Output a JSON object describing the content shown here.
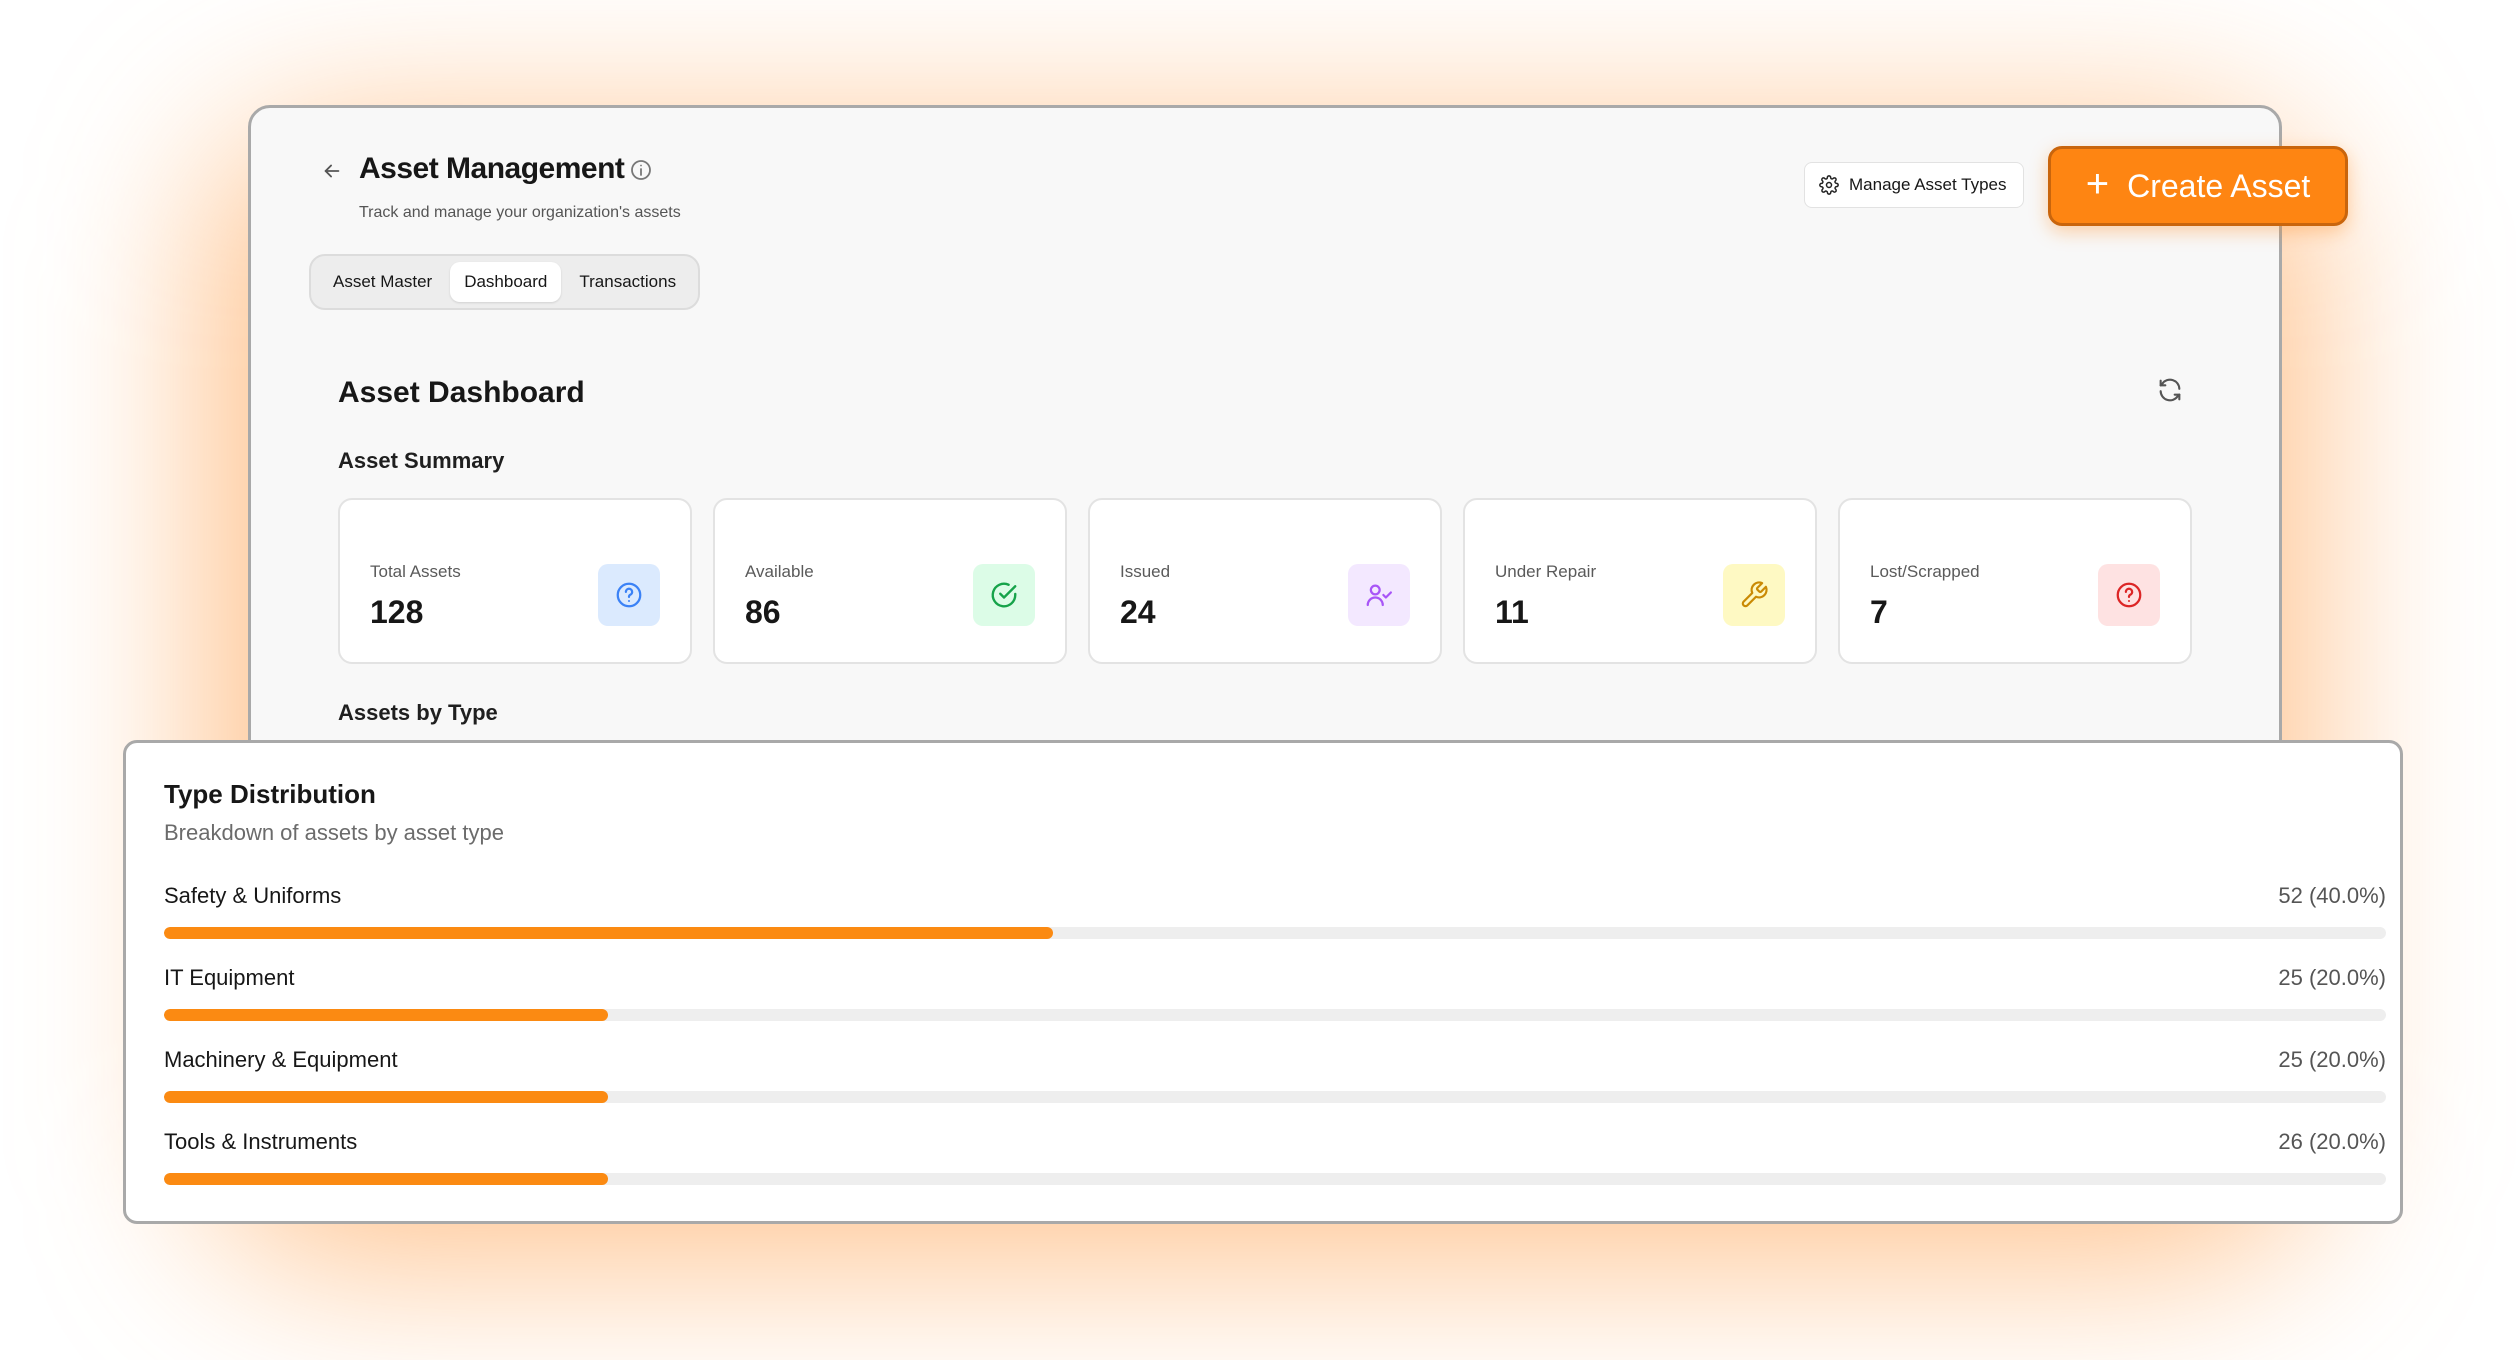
{
  "header": {
    "title": "Asset Management",
    "subtitle": "Track and manage your organization's assets",
    "manage_label": "Manage Asset Types",
    "create_label": "Create Asset"
  },
  "tabs": [
    {
      "label": "Asset Master",
      "active": false
    },
    {
      "label": "Dashboard",
      "active": true
    },
    {
      "label": "Transactions",
      "active": false
    }
  ],
  "dashboard": {
    "title": "Asset Dashboard",
    "summary_title": "Asset Summary",
    "by_type_title": "Assets by Type"
  },
  "summary_cards": [
    {
      "label": "Total Assets",
      "value": "128",
      "icon": "question-circle-icon",
      "icon_color": "#3b82f6",
      "icon_bg": "#dbeafe"
    },
    {
      "label": "Available",
      "value": "86",
      "icon": "check-circle-icon",
      "icon_color": "#16a34a",
      "icon_bg": "#dcfce7"
    },
    {
      "label": "Issued",
      "value": "24",
      "icon": "user-check-icon",
      "icon_color": "#a855f7",
      "icon_bg": "#f3e8ff"
    },
    {
      "label": "Under Repair",
      "value": "11",
      "icon": "wrench-icon",
      "icon_color": "#ca8a04",
      "icon_bg": "#fef9c3"
    },
    {
      "label": "Lost/Scrapped",
      "value": "7",
      "icon": "question-circle-icon",
      "icon_color": "#dc2626",
      "icon_bg": "#fee2e2"
    }
  ],
  "distribution": {
    "title": "Type Distribution",
    "subtitle": "Breakdown of assets by asset type",
    "items": [
      {
        "name": "Safety & Uniforms",
        "value_text": "52 (40.0%)",
        "percent": 40.0
      },
      {
        "name": "IT Equipment",
        "value_text": "25 (20.0%)",
        "percent": 20.0
      },
      {
        "name": "Machinery & Equipment",
        "value_text": "25 (20.0%)",
        "percent": 20.0
      },
      {
        "name": "Tools & Instruments",
        "value_text": "26 (20.0%)",
        "percent": 20.0
      }
    ]
  },
  "colors": {
    "accent": "#fe8512",
    "bar_fill": "#fb8a12",
    "bar_track": "#eeeeee"
  }
}
